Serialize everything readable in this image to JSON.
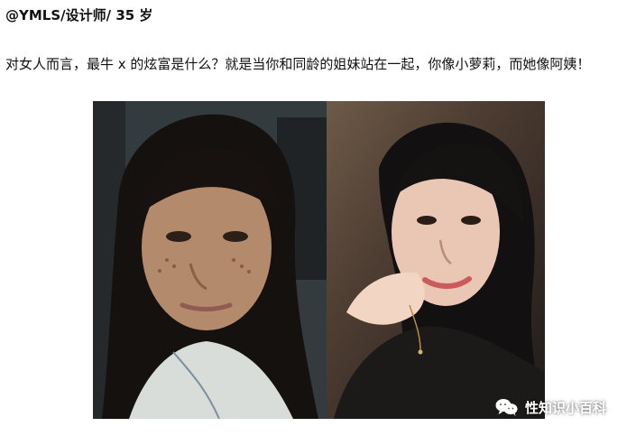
{
  "header": {
    "text": "@YMLS/设计师/ 35 岁"
  },
  "paragraph": {
    "text": "对女人而言，最牛 x 的炫富是什么？就是当你和同龄的姐妹站在一起，你像小萝莉，而她像阿姨！"
  },
  "photos": {
    "left": {
      "subject": "woman-without-makeup-photo"
    },
    "right": {
      "subject": "woman-with-makeup-photo"
    }
  },
  "watermark": {
    "icon": "wechat-icon",
    "text": "性知识小百科"
  }
}
